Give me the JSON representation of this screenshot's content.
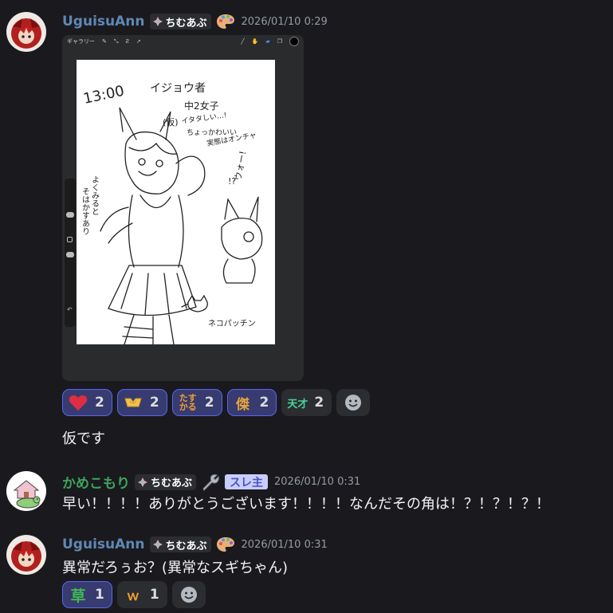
{
  "messages": [
    {
      "username": "UguisuAnn",
      "username_color": "#5f88b4",
      "tag": "ちむあぶ",
      "timestamp": "2026/01/10 0:29",
      "attachment": {
        "toolbar_gallery": "ギャラリー",
        "sketch_texts": [
          "13:00",
          "イジョウ者",
          "中2女子",
          "(仮)",
          "イタタしい…!",
          "ちょっかわいい",
          "実態はオンチャ",
          "ウォー!",
          "よくみるとそはかすあり",
          "ネコパッチン"
        ]
      },
      "reactions": [
        {
          "emoji": "heart",
          "count": "2",
          "me": true
        },
        {
          "emoji": "emote-hands",
          "count": "2",
          "me": true
        },
        {
          "emoji": "emote-tasukaru",
          "count": "2",
          "me": true
        },
        {
          "emoji": "emote-ijou",
          "count": "2",
          "me": true
        },
        {
          "emoji": "emote-tensai",
          "count": "2",
          "me": false
        }
      ],
      "text": "仮です"
    },
    {
      "username": "かめこもり",
      "username_color": "#3ba55c",
      "tag": "ちむあぶ",
      "owner_badge": "スレ主",
      "timestamp": "2026/01/10 0:31",
      "text": "早い！！！！ありがとうございます！！！！なんだその角は！？！？！？！"
    },
    {
      "username": "UguisuAnn",
      "username_color": "#5f88b4",
      "tag": "ちむあぶ",
      "timestamp": "2026/01/10 0:31",
      "text": "異常だろぅお？(異常なスギちゃん)",
      "reactions": [
        {
          "emoji": "emote-kusa",
          "count": "1",
          "me": true
        },
        {
          "emoji": "emote-wara",
          "count": "1",
          "me": false
        }
      ]
    }
  ]
}
